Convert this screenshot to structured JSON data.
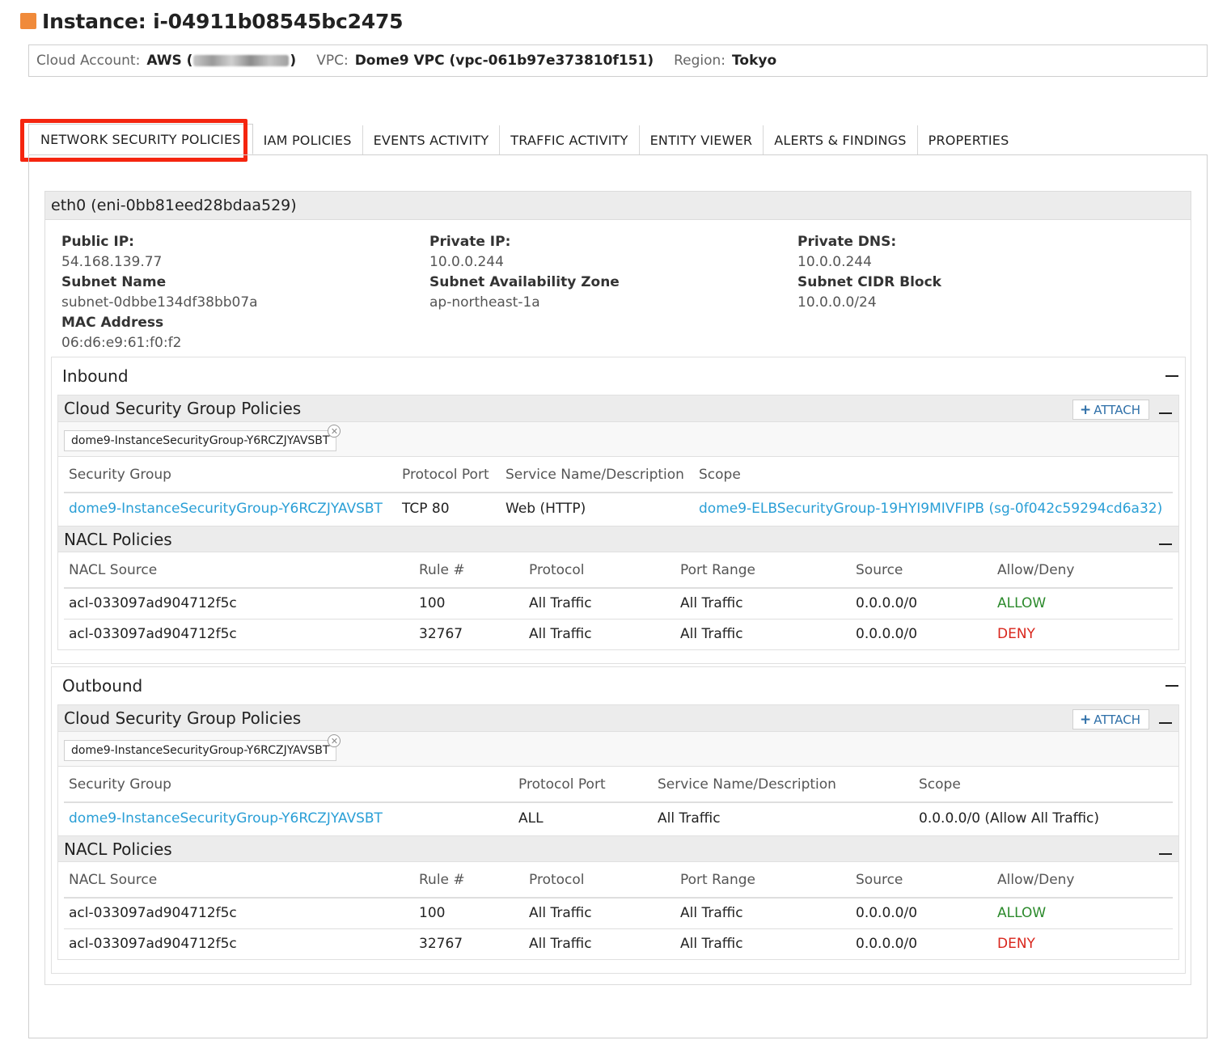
{
  "page": {
    "title": "Instance: i-04911b08545bc2475"
  },
  "meta": {
    "cloud_account_label": "Cloud Account:",
    "cloud_account_prefix": "AWS (",
    "cloud_account_suffix": ")",
    "vpc_label": "VPC:",
    "vpc_value": "Dome9 VPC (vpc-061b97e373810f151)",
    "region_label": "Region:",
    "region_value": "Tokyo"
  },
  "tabs": [
    {
      "label": "NETWORK SECURITY POLICIES",
      "active": true
    },
    {
      "label": "IAM POLICIES"
    },
    {
      "label": "EVENTS ACTIVITY"
    },
    {
      "label": "TRAFFIC ACTIVITY"
    },
    {
      "label": "ENTITY VIEWER"
    },
    {
      "label": "ALERTS & FINDINGS"
    },
    {
      "label": "PROPERTIES"
    }
  ],
  "eni": {
    "header": "eth0 (eni-0bb81eed28bdaa529)",
    "public_ip_label": "Public IP:",
    "public_ip": "54.168.139.77",
    "private_ip_label": "Private IP:",
    "private_ip": "10.0.0.244",
    "private_dns_label": "Private DNS:",
    "private_dns": "10.0.0.244",
    "subnet_name_label": "Subnet Name",
    "subnet_name": "subnet-0dbbe134df38bb07a",
    "subnet_az_label": "Subnet Availability Zone",
    "subnet_az": "ap-northeast-1a",
    "subnet_cidr_label": "Subnet CIDR Block",
    "subnet_cidr": "10.0.0.0/24",
    "mac_label": "MAC Address",
    "mac": "06:d6:e9:61:f0:f2"
  },
  "inbound": {
    "title": "Inbound",
    "csg_title": "Cloud Security Group Policies",
    "attach_label": "ATTACH",
    "chip": "dome9-InstanceSecurityGroup-Y6RCZJYAVSBT",
    "sg_headers": [
      "Security Group",
      "Protocol Port",
      "Service Name/Description",
      "Scope"
    ],
    "sg_rows": [
      [
        "dome9-InstanceSecurityGroup-Y6RCZJYAVSBT",
        "TCP 80",
        "Web (HTTP)",
        "dome9-ELBSecurityGroup-19HYI9MIVFIPB (sg-0f042c59294cd6a32)"
      ]
    ],
    "nacl_title": "NACL Policies",
    "nacl_headers": [
      "NACL Source",
      "Rule #",
      "Protocol",
      "Port Range",
      "Source",
      "Allow/Deny"
    ],
    "nacl_rows": [
      [
        "acl-033097ad904712f5c",
        "100",
        "All Traffic",
        "All Traffic",
        "0.0.0.0/0",
        "ALLOW"
      ],
      [
        "acl-033097ad904712f5c",
        "32767",
        "All Traffic",
        "All Traffic",
        "0.0.0.0/0",
        "DENY"
      ]
    ]
  },
  "outbound": {
    "title": "Outbound",
    "csg_title": "Cloud Security Group Policies",
    "attach_label": "ATTACH",
    "chip": "dome9-InstanceSecurityGroup-Y6RCZJYAVSBT",
    "sg_headers": [
      "Security Group",
      "Protocol Port",
      "Service Name/Description",
      "Scope"
    ],
    "sg_rows": [
      [
        "dome9-InstanceSecurityGroup-Y6RCZJYAVSBT",
        "ALL",
        "All Traffic",
        "0.0.0.0/0 (Allow All Traffic)"
      ]
    ],
    "nacl_title": "NACL Policies",
    "nacl_headers": [
      "NACL Source",
      "Rule #",
      "Protocol",
      "Port Range",
      "Source",
      "Allow/Deny"
    ],
    "nacl_rows": [
      [
        "acl-033097ad904712f5c",
        "100",
        "All Traffic",
        "All Traffic",
        "0.0.0.0/0",
        "ALLOW"
      ],
      [
        "acl-033097ad904712f5c",
        "32767",
        "All Traffic",
        "All Traffic",
        "0.0.0.0/0",
        "DENY"
      ]
    ]
  },
  "colors": {
    "accent_square": "#f08a3a",
    "highlight": "#f5250f",
    "link": "#2a9fd6",
    "allow": "#2c8a2c",
    "deny": "#d9261c"
  }
}
